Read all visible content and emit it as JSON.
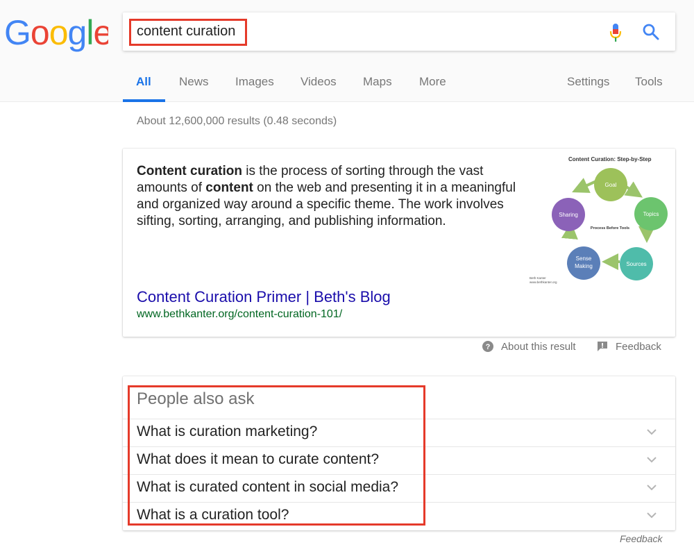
{
  "logo": {
    "text": "Google",
    "letters": [
      "G",
      "o",
      "o",
      "g",
      "l",
      "e"
    ],
    "letter_colors": [
      "#4285F4",
      "#EA4335",
      "#FBBC05",
      "#4285F4",
      "#34A853",
      "#EA4335"
    ]
  },
  "search": {
    "query": "content curation",
    "mic_icon": "mic-icon",
    "search_icon": "search-icon"
  },
  "tabs": {
    "all": "All",
    "news": "News",
    "images": "Images",
    "videos": "Videos",
    "maps": "Maps",
    "more": "More",
    "settings": "Settings",
    "tools": "Tools",
    "active": "All"
  },
  "stats": "About 12,600,000 results (0.48 seconds)",
  "featured": {
    "snippet_parts": [
      {
        "text": "Content curation",
        "bold": true
      },
      {
        "text": " is the process of sorting through the vast amounts of ",
        "bold": false
      },
      {
        "text": "content",
        "bold": true
      },
      {
        "text": " on the web and presenting it in a meaningful and organized way around a specific theme. The work involves sifting, sorting, arranging, and publishing information.",
        "bold": false
      }
    ],
    "title": "Content Curation Primer | Beth's Blog",
    "url": "www.bethkanter.org/content-curation-101/",
    "diagram": {
      "title": "Content Curation:  Step-by-Step",
      "nodes": [
        {
          "label": "Goal",
          "color": "#9dc15a"
        },
        {
          "label": "Topics",
          "color": "#6cc46e"
        },
        {
          "label": "Sources",
          "color": "#4fbcaa"
        },
        {
          "label": "Sense Making",
          "color": "#5b7fb8"
        },
        {
          "label": "Sharing",
          "color": "#8b62b8"
        }
      ],
      "center": "Process Before Tools",
      "credit_name": "Beth Kanter",
      "credit_url": "www.bethkanter.org"
    }
  },
  "result_meta": {
    "about": "About this result",
    "feedback": "Feedback"
  },
  "paa": {
    "title": "People also ask",
    "questions": [
      "What is curation marketing?",
      "What does it mean to curate content?",
      "What is curated content in social media?",
      "What is a curation tool?"
    ]
  },
  "bottom_feedback": "Feedback",
  "colors": {
    "link": "#1a0dab",
    "url": "#006621",
    "accent": "#1a73e8",
    "highlight": "#e53a2a"
  }
}
